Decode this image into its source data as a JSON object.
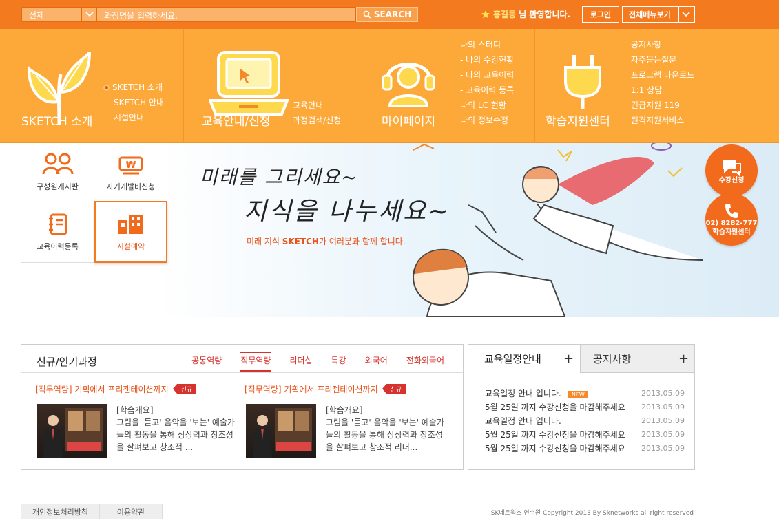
{
  "search": {
    "category": "전체",
    "placeholder": "과정명을 입력하세요.",
    "button": "SEARCH"
  },
  "user": {
    "name": "홍길동",
    "greeting": "님 환영합니다.",
    "login": "로그인",
    "all_menu": "전체메뉴보기"
  },
  "nav": {
    "sketch": {
      "title": "SKETCH 소개",
      "links": [
        "SKETCH 소개",
        "SKETCH 안내",
        "시설안내"
      ]
    },
    "edu": {
      "title": "교육안내/신청",
      "links": [
        "교육안내",
        "과정검색/신청"
      ]
    },
    "mypage": {
      "title": "마이페이지",
      "links": [
        "나의 스터디",
        "- 나의 수강현황",
        "- 나의 교육이력",
        "- 교육이력 등록",
        "나의 LC 현황",
        "나의 정보수정"
      ]
    },
    "support": {
      "title": "학습지원센터",
      "links": [
        "공지사항",
        "자주묻는질문",
        "프로그램 다운로드",
        "1:1 상담",
        "긴급지원 119",
        "원격지원서비스"
      ]
    }
  },
  "quick": {
    "board": "구성원게시판",
    "selfdev": "자기개발비신청",
    "history": "교육이력등록",
    "facility": "시설예약"
  },
  "hero": {
    "line1": "미래를 그리세요~",
    "line2": "지식을 나누세요~",
    "caption_a": "미래 지식 ",
    "caption_b": "SKETCH",
    "caption_c": "가 여러분과 함께 합니다."
  },
  "side": {
    "apply": "수강신청",
    "phone": "02) 8282-777",
    "center": "학습지원센터"
  },
  "courses": {
    "title": "신규/인기과정",
    "tabs": [
      "공통역량",
      "직무역량",
      "리더십",
      "특강",
      "외국어",
      "전화외국어"
    ],
    "active_tab": "직무역량",
    "items": [
      {
        "title": "[직무역량] 기획에서 프리젠테이션까지",
        "badge": "신규",
        "label": "[학습개요]",
        "desc": "그림을 '듣고' 음악을 '보는' 예술가들의 활동을 통해 상상력과 창조성을 살펴보고 창조적 ..."
      },
      {
        "title": "[직무역량] 기획에서 프리젠테이션까지",
        "badge": "신규",
        "label": "[학습개요]",
        "desc": "그림을 '듣고' 음악을 '보는' 예술가들의 활동을 통해 상상력과 창조성을 살펴보고 창조적 리더..."
      }
    ]
  },
  "notice": {
    "tab1": "교육일정안내",
    "tab2": "공지사항",
    "rows": [
      {
        "text": "교육일정 안내 입니다.",
        "new": "NEW",
        "date": "2013.05.09"
      },
      {
        "text": "5월 25일 까지 수강신청을 마감해주세요",
        "date": "2013.05.09"
      },
      {
        "text": "교육일정 안내 입니다.",
        "date": "2013.05.09"
      },
      {
        "text": "5월 25일 까지 수강신청을 마감해주세요",
        "date": "2013.05.09"
      },
      {
        "text": "5월 25일 까지 수강신청을 마감해주세요",
        "date": "2013.05.09"
      }
    ]
  },
  "footer": {
    "privacy": "개인정보처리방침",
    "terms": "이용약관",
    "copyright": "SK네트웍스 연수원 Copyright 2013 By Sknetworks all right reserved"
  },
  "colors": {
    "topbar": "#f47a20",
    "nav": "#fca93a",
    "accent_red": "#d6332e",
    "accent_orange": "#e8541a"
  }
}
